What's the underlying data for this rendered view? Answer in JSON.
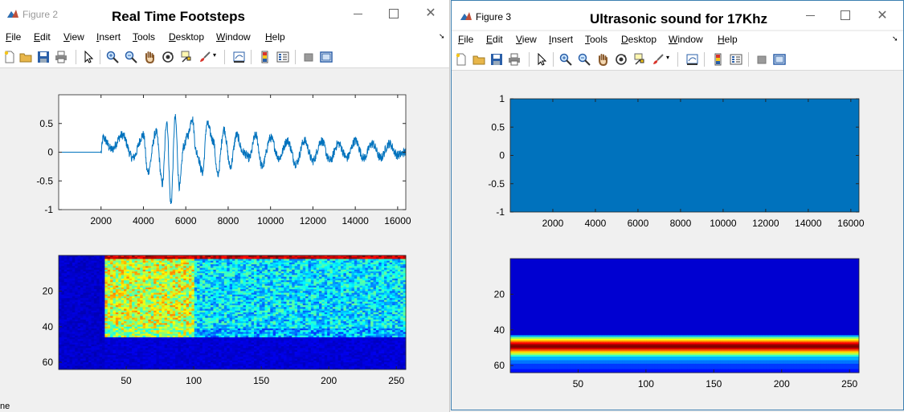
{
  "figures": [
    {
      "label": "Figure 2",
      "title": "Real Time Footsteps",
      "menu": [
        "File",
        "Edit",
        "View",
        "Insert",
        "Tools",
        "Desktop",
        "Window",
        "Help"
      ],
      "waveform": {
        "type": "line",
        "xlim": [
          0,
          16384
        ],
        "ylim": [
          -1,
          1
        ],
        "xticks": [
          2000,
          4000,
          6000,
          8000,
          10000,
          12000,
          14000,
          16000
        ],
        "yticks": [
          0.5,
          0,
          -0.5,
          -1
        ],
        "ytick_labels": [
          "0.5",
          "0",
          "-0.5",
          "-1"
        ],
        "color": "#0072bd",
        "x": [
          0,
          2000,
          2100,
          2500,
          3000,
          3500,
          4000,
          4200,
          4600,
          4900,
          5100,
          5300,
          5500,
          5700,
          5900,
          6100,
          6300,
          6500,
          6800,
          7000,
          7300,
          7500,
          7800,
          8100,
          8400,
          8700,
          9000,
          9300,
          9600,
          10000,
          10400,
          10800,
          11200,
          11600,
          12000,
          12400,
          12800,
          13200,
          13600,
          14000,
          14400,
          14800,
          15200,
          15600,
          16000,
          16384
        ],
        "y": [
          0,
          0,
          0.25,
          0.05,
          0.3,
          -0.1,
          0.3,
          -0.35,
          0.35,
          -0.55,
          0.55,
          -0.9,
          0.6,
          -0.6,
          0.1,
          0.3,
          0.6,
          0.0,
          -0.35,
          0.5,
          0.2,
          -0.4,
          0.4,
          -0.25,
          0.3,
          0.0,
          -0.1,
          0.3,
          -0.25,
          0.25,
          -0.1,
          0.2,
          -0.2,
          0.2,
          -0.15,
          0.2,
          -0.15,
          0.15,
          -0.1,
          0.2,
          -0.1,
          0.15,
          -0.1,
          0.15,
          -0.05,
          0.0
        ]
      },
      "spectrogram": {
        "type": "heatmap",
        "colormap": "jet",
        "xticks": [
          50,
          100,
          150,
          200,
          250
        ],
        "yticks": [
          20,
          40,
          60
        ],
        "xlim": [
          0,
          257
        ],
        "ylim": [
          0,
          64
        ]
      }
    },
    {
      "label": "Figure 3",
      "title": "Ultrasonic sound for 17Khz",
      "menu": [
        "File",
        "Edit",
        "View",
        "Insert",
        "Tools",
        "Desktop",
        "Window",
        "Help"
      ],
      "waveform": {
        "type": "area",
        "xlim": [
          0,
          16384
        ],
        "ylim": [
          -1,
          1
        ],
        "xticks": [
          2000,
          4000,
          6000,
          8000,
          10000,
          12000,
          14000,
          16000
        ],
        "yticks": [
          1,
          0.5,
          0,
          -0.5,
          -1
        ],
        "ytick_labels": [
          "1",
          "0.5",
          "0",
          "-0.5",
          "-1"
        ],
        "color": "#0072bd",
        "x": [
          0,
          16384
        ],
        "y": [
          1,
          1
        ]
      },
      "spectrogram": {
        "type": "heatmap",
        "colormap": "jet",
        "xticks": [
          50,
          100,
          150,
          200,
          250
        ],
        "yticks": [
          20,
          40,
          60
        ],
        "xlim": [
          0,
          257
        ],
        "ylim": [
          0,
          64
        ]
      }
    }
  ],
  "status_fragment": "ne"
}
